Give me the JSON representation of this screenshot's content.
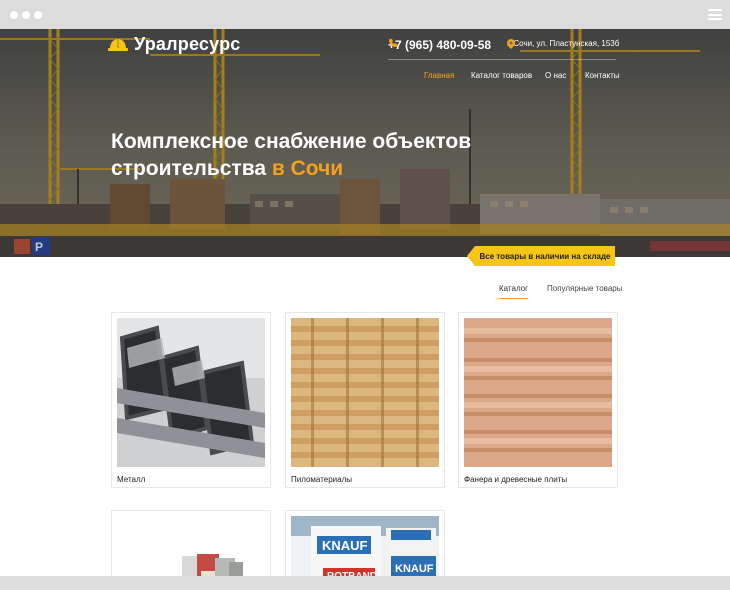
{
  "brand": {
    "name": "Уралресурс"
  },
  "header": {
    "phone": "+7 (965) 480-09-58",
    "address": "г. Сочи, ул. Пластунская, 153б"
  },
  "nav": {
    "items": [
      {
        "label": "Главная",
        "active": true
      },
      {
        "label": "Каталог товаров",
        "active": false
      },
      {
        "label": "О нас",
        "active": false
      },
      {
        "label": "Контакты",
        "active": false
      }
    ]
  },
  "hero": {
    "headline_line1": "Комплексное снабжение объектов",
    "headline_line2": "строительства",
    "headline_accent": "в Сочи",
    "stock_badge": "Все товары в наличии на складе"
  },
  "tabs": [
    {
      "label": "Каталог",
      "active": true
    },
    {
      "label": "Популярные товары",
      "active": false
    }
  ],
  "catalog": [
    {
      "title": "Металл",
      "image": "metal-profiles-image"
    },
    {
      "title": "Пиломатериалы",
      "image": "lumber-stack-image"
    },
    {
      "title": "Фанера и древесные плиты",
      "image": "plywood-stack-image"
    },
    {
      "title": "",
      "image": "mortar-bags-image"
    },
    {
      "title": "",
      "image": "knauf-rotband-bags-image"
    }
  ],
  "colors": {
    "accent": "#f5a020",
    "badge": "#f5c518"
  }
}
